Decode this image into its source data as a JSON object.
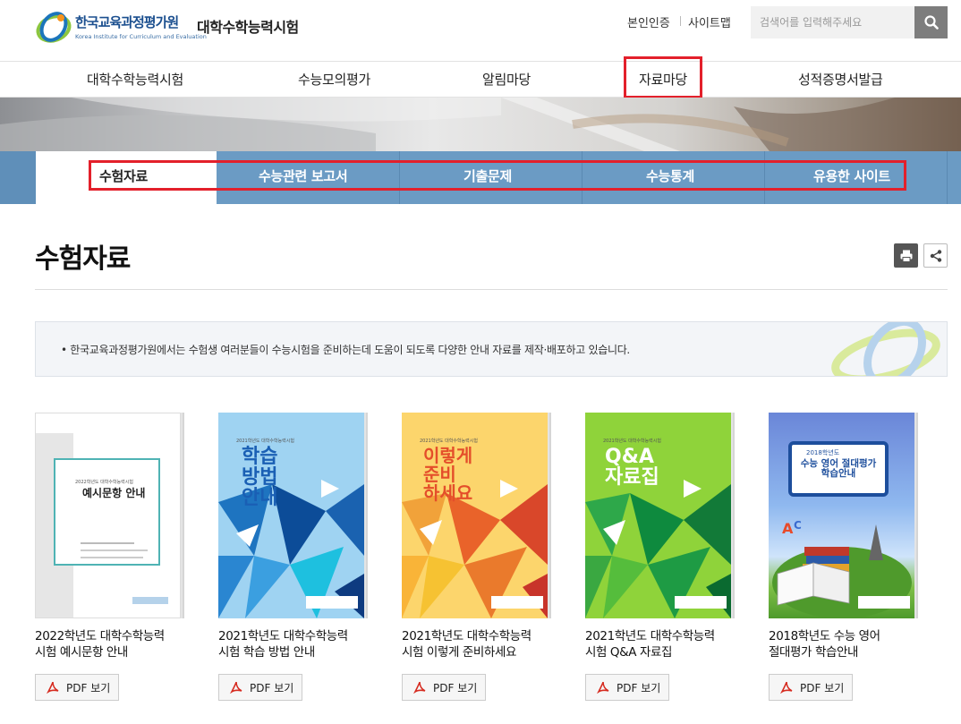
{
  "header": {
    "logo_kor": "한국교육과정평가원",
    "logo_eng": "Korea Institute for Curriculum and Evaluation",
    "site_name": "대학수학능력시험",
    "util_links": [
      "본인인증",
      "사이트맵"
    ],
    "search_placeholder": "검색어를 입력해주세요"
  },
  "gnb": [
    "대학수학능력시험",
    "수능모의평가",
    "알림마당",
    "자료마당",
    "성적증명서발급"
  ],
  "subnav": [
    "수험자료",
    "수능관련 보고서",
    "기출문제",
    "수능통계",
    "유용한 사이트"
  ],
  "page": {
    "title": "수험자료",
    "info": "• 한국교육과정평가원에서는 수험생 여러분들이 수능시험을 준비하는데 도움이 되도록 다양한 안내 자료를 제작·배포하고 있습니다."
  },
  "books": [
    {
      "title_line1": "2022학년도 대학수학능력",
      "title_line2": "시험 예시문항 안내",
      "pdf": "PDF 보기",
      "cover_text": "예시문항 안내",
      "cover_sub": "2022학년도 대학수학능력시험"
    },
    {
      "title_line1": "2021학년도 대학수학능력",
      "title_line2": "시험 학습 방법 안내",
      "pdf": "PDF 보기",
      "cover_text": "학습\n방법\n안내",
      "cover_sub": "2021학년도 대학수학능력시험"
    },
    {
      "title_line1": "2021학년도 대학수학능력",
      "title_line2": "시험 이렇게 준비하세요",
      "pdf": "PDF 보기",
      "cover_text": "이렇게\n준비\n하세요",
      "cover_sub": "2021학년도 대학수학능력시험"
    },
    {
      "title_line1": "2021학년도 대학수학능력",
      "title_line2": "시험 Q&A 자료집",
      "pdf": "PDF 보기",
      "cover_text": "Q&A\n자료집",
      "cover_sub": "2021학년도 대학수학능력시험"
    },
    {
      "title_line1": "2018학년도 수능 영어",
      "title_line2": "절대평가 학습안내",
      "pdf": "PDF 보기",
      "cover_text": "수능 영어 절대평가\n학습안내",
      "cover_sub": "2018학년도"
    }
  ],
  "colors": {
    "accent_red": "#e3202b",
    "subnav_blue": "#6b9bc4",
    "pdf_red": "#d62b20"
  }
}
